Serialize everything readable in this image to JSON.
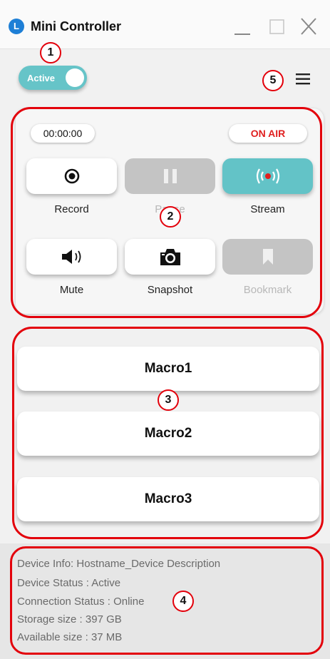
{
  "window": {
    "logo_letter": "L",
    "title": "Mini Controller",
    "controls": [
      "minimize-icon",
      "maximize-icon",
      "close-icon"
    ]
  },
  "toggle": {
    "label": "Active",
    "state": "on",
    "color": "#66c4c8"
  },
  "menu": {
    "icon": "hamburger-menu-icon"
  },
  "annotations": [
    "1",
    "2",
    "3",
    "4",
    "5"
  ],
  "annotation_color": "#e3000b",
  "control_panel": {
    "timer": "00:00:00",
    "on_air_label": "ON AIR",
    "on_air_color": "#e02020",
    "buttons": [
      {
        "label": "Record",
        "icon": "record-icon",
        "state": "enabled"
      },
      {
        "label": "Pause",
        "icon": "pause-icon",
        "state": "disabled"
      },
      {
        "label": "Stream",
        "icon": "broadcast-icon",
        "state": "active",
        "color": "#63c3c7"
      },
      {
        "label": "Mute",
        "icon": "speaker-icon",
        "state": "enabled"
      },
      {
        "label": "Snapshot",
        "icon": "camera-icon",
        "state": "enabled"
      },
      {
        "label": "Bookmark",
        "icon": "bookmark-icon",
        "state": "disabled"
      }
    ]
  },
  "macros": [
    {
      "label": "Macro1"
    },
    {
      "label": "Macro2"
    },
    {
      "label": "Macro3"
    }
  ],
  "device_info": {
    "lines": [
      "Device Info: Hostname_Device Description",
      "Device Status : Active",
      "Connection Status : Online",
      "Storage size : 397 GB",
      "Available size : 37 MB"
    ]
  }
}
